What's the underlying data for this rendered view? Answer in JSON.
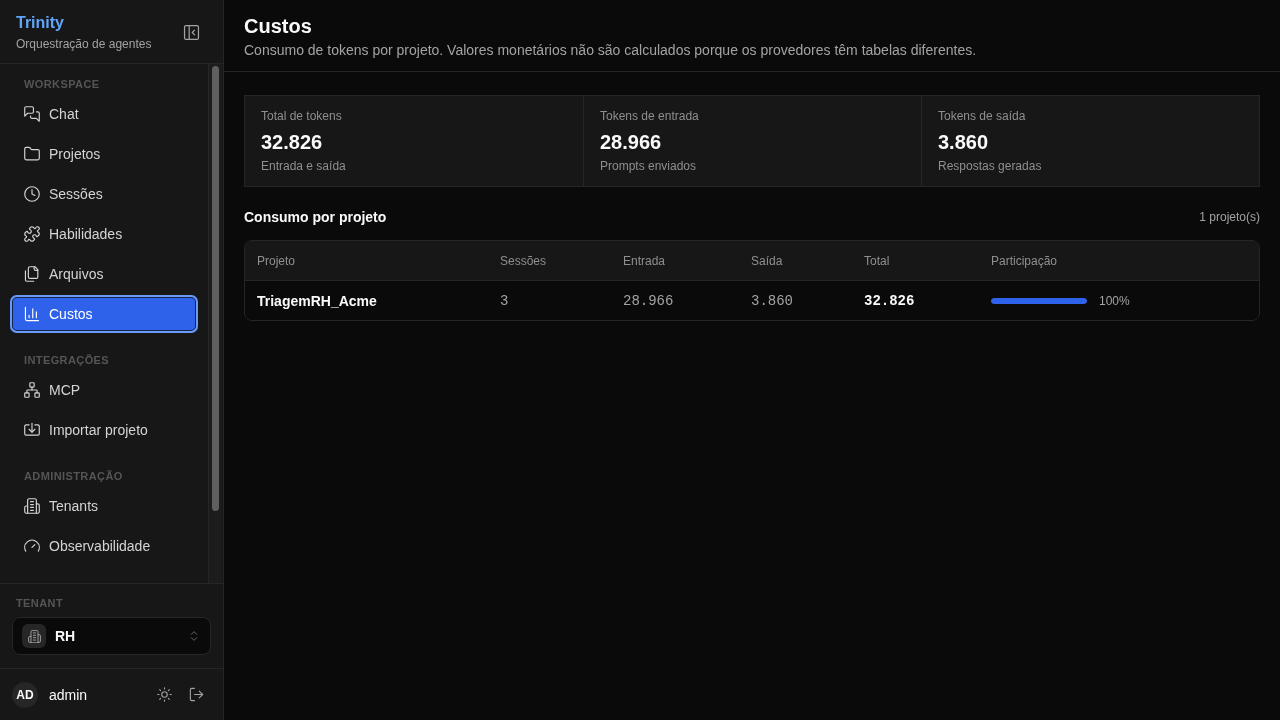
{
  "sidebar": {
    "brand": {
      "title": "Trinity",
      "subtitle": "Orquestração de agentes"
    },
    "sections": [
      {
        "heading": "WORKSPACE",
        "items": [
          {
            "label": "Chat",
            "selected": false
          },
          {
            "label": "Projetos",
            "selected": false
          },
          {
            "label": "Sessões",
            "selected": false
          },
          {
            "label": "Habilidades",
            "selected": false
          },
          {
            "label": "Arquivos",
            "selected": false
          },
          {
            "label": "Custos",
            "selected": true
          }
        ]
      },
      {
        "heading": "INTEGRAÇÕES",
        "items": [
          {
            "label": "MCP",
            "selected": false
          },
          {
            "label": "Importar projeto",
            "selected": false
          }
        ]
      },
      {
        "heading": "ADMINISTRAÇÃO",
        "items": [
          {
            "label": "Tenants",
            "selected": false
          },
          {
            "label": "Observabilidade",
            "selected": false
          }
        ]
      }
    ],
    "tenant": {
      "heading": "TENANT",
      "value": "RH"
    },
    "user": {
      "initials": "AD",
      "name": "admin"
    }
  },
  "header": {
    "title": "Custos",
    "description": "Consumo de tokens por projeto. Valores monetários não são calculados porque os provedores têm tabelas diferentes."
  },
  "stats": [
    {
      "label": "Total de tokens",
      "value": "32.826",
      "caption": "Entrada e saída"
    },
    {
      "label": "Tokens de entrada",
      "value": "28.966",
      "caption": "Prompts enviados"
    },
    {
      "label": "Tokens de saída",
      "value": "3.860",
      "caption": "Respostas geradas"
    }
  ],
  "projects": {
    "title": "Consumo por projeto",
    "count": "1 projeto(s)",
    "table": {
      "columns": [
        {
          "label": "Projeto",
          "kind": "name"
        },
        {
          "label": "Sessões",
          "kind": "number"
        },
        {
          "label": "Entrada",
          "kind": "number"
        },
        {
          "label": "Saída",
          "kind": "number"
        },
        {
          "label": "Total",
          "kind": "total"
        },
        {
          "label": "Participação",
          "kind": "share"
        }
      ],
      "rows": [
        {
          "cells": [
            "TriagemRH_Acme",
            "3",
            "28.966",
            "3.860",
            "32.826"
          ],
          "share": {
            "level": 1,
            "reading": "100%"
          }
        }
      ]
    }
  }
}
